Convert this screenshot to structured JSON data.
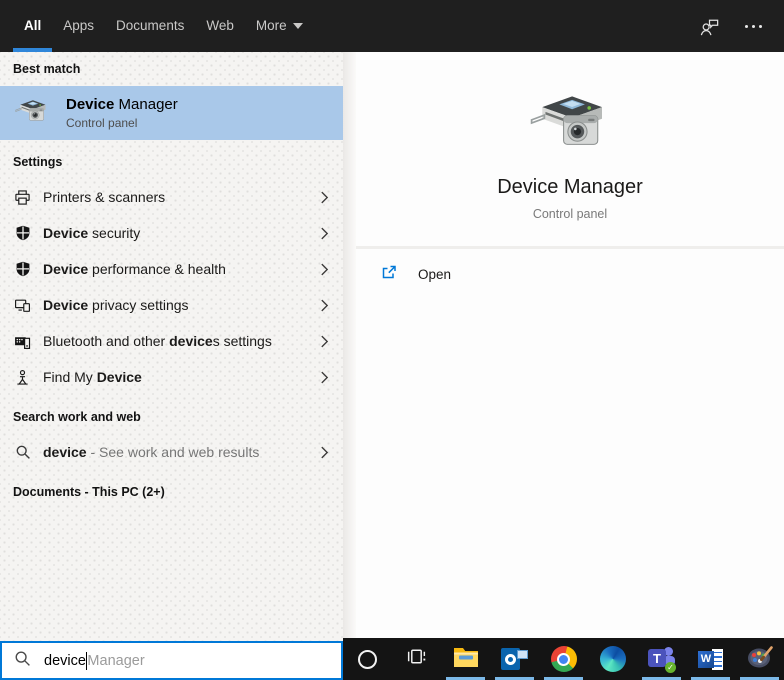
{
  "colors": {
    "accent": "#0078d7",
    "highlight": "#a9c8e9",
    "tab_underline": "#2f86d9",
    "taskbar_indicator": "#7cb9e8",
    "topbar_bg": "#1f1f1f",
    "taskbar_bg": "#141414"
  },
  "topbar": {
    "tabs": [
      {
        "label": "All",
        "active": true
      },
      {
        "label": "Apps",
        "active": false
      },
      {
        "label": "Documents",
        "active": false
      },
      {
        "label": "Web",
        "active": false
      }
    ],
    "more_label": "More",
    "right_icons": [
      "feedback-icon",
      "more-options-icon"
    ]
  },
  "left_panel": {
    "best_match": {
      "header": "Best match",
      "title_bold": "Device",
      "title_rest": " Manager",
      "subtitle": "Control panel",
      "icon": "device-manager-icon"
    },
    "settings": {
      "header": "Settings",
      "items": [
        {
          "icon": "printer-icon",
          "pre": "Printers & scanners",
          "bold": "",
          "post": ""
        },
        {
          "icon": "shield-icon",
          "pre": "",
          "bold": "Device",
          "post": " security"
        },
        {
          "icon": "shield-icon",
          "pre": "",
          "bold": "Device",
          "post": " performance & health"
        },
        {
          "icon": "devices-icon",
          "pre": "",
          "bold": "Device",
          "post": " privacy settings"
        },
        {
          "icon": "bluetooth-devices-icon",
          "pre": "Bluetooth and other ",
          "bold": "device",
          "post": "s settings"
        },
        {
          "icon": "find-my-device-icon",
          "pre": "Find My ",
          "bold": "Device",
          "post": ""
        }
      ]
    },
    "search_web": {
      "header": "Search work and web",
      "item": {
        "icon": "search-icon",
        "bold": "device",
        "post": " - See work and web results"
      }
    },
    "documents_header": "Documents - This PC (2+)"
  },
  "preview": {
    "icon": "device-manager-icon",
    "title": "Device Manager",
    "subtitle": "Control panel",
    "open_label": "Open"
  },
  "search_box": {
    "icon": "search-icon",
    "typed": "device",
    "suggestion": "Manager"
  },
  "taskbar": {
    "items": [
      {
        "name": "cortana",
        "open": false
      },
      {
        "name": "task-view",
        "open": false
      },
      {
        "name": "file-explorer",
        "open": true
      },
      {
        "name": "outlook",
        "open": true
      },
      {
        "name": "chrome",
        "open": true
      },
      {
        "name": "edge",
        "open": false
      },
      {
        "name": "teams",
        "open": true
      },
      {
        "name": "word",
        "open": true
      },
      {
        "name": "paint",
        "open": true
      }
    ]
  }
}
